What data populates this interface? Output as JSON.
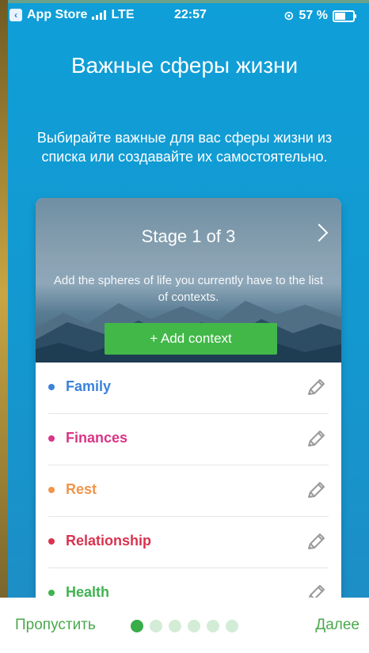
{
  "status_bar": {
    "carrier": "App Store",
    "network": "LTE",
    "time": "22:57",
    "battery": "57 %",
    "battery_level": 0.57
  },
  "header": {
    "title": "Важные сферы жизни",
    "subtitle": "Выбирайте важные для вас сферы жизни из списка или создавайте их самостоятельно."
  },
  "card": {
    "stage": "Stage 1 of 3",
    "hint": "Add the spheres of life you currently have to the list of contexts.",
    "add_button": "+ Add context",
    "items": [
      {
        "label": "Family",
        "color": "#3b82db"
      },
      {
        "label": "Finances",
        "color": "#d93586"
      },
      {
        "label": "Rest",
        "color": "#f0954b"
      },
      {
        "label": "Relationship",
        "color": "#d9334f"
      },
      {
        "label": "Health",
        "color": "#3fb34f"
      }
    ]
  },
  "footer": {
    "skip": "Пропустить",
    "next": "Далее",
    "page_count": 6,
    "active_page": 1
  },
  "colors": {
    "background": "#1497cf",
    "accent": "#42b849"
  }
}
